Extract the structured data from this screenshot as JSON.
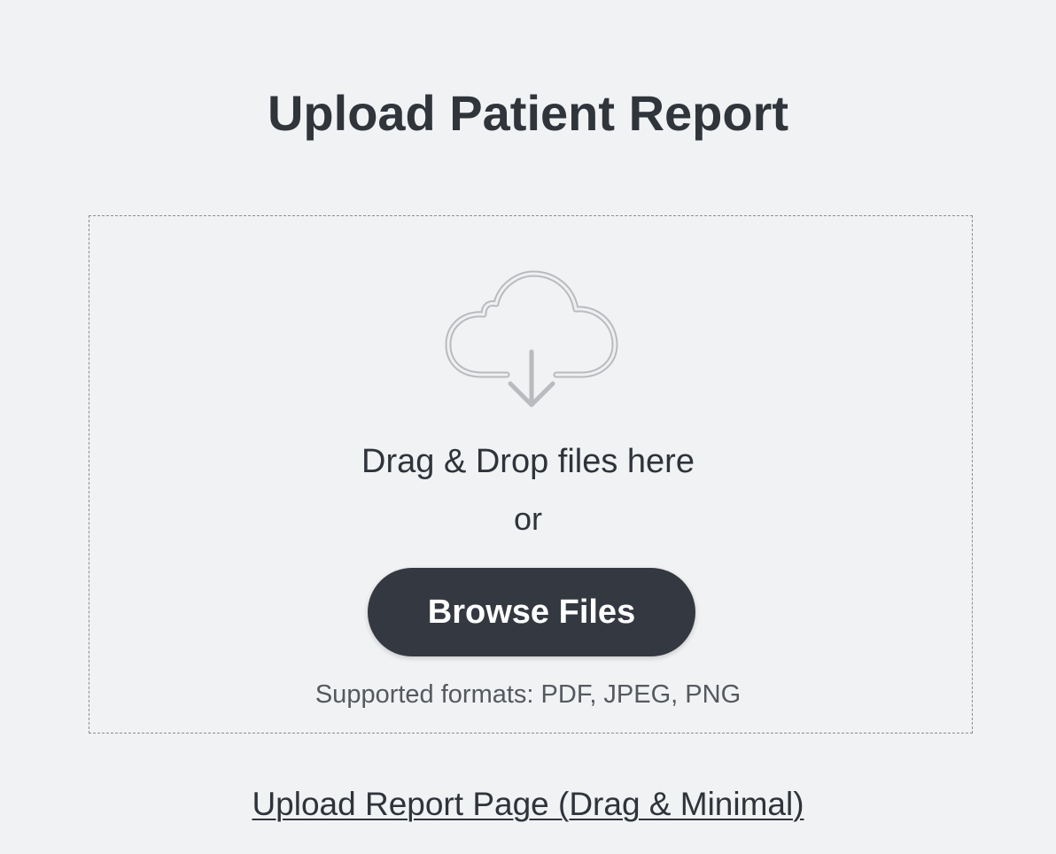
{
  "page": {
    "title": "Upload Patient Report"
  },
  "dropzone": {
    "icon": "cloud-download-icon",
    "drag_text": "Drag & Drop files here",
    "or_text": "or",
    "browse_label": "Browse Files",
    "supported_formats": "Supported formats: PDF, JPEG, PNG"
  },
  "footer": {
    "link_text": "Upload Report Page (Drag & Minimal)"
  },
  "colors": {
    "background": "#f1f2f4",
    "button": "#343941",
    "text": "#2f333a",
    "icon_stroke": "#b9bbbe"
  }
}
